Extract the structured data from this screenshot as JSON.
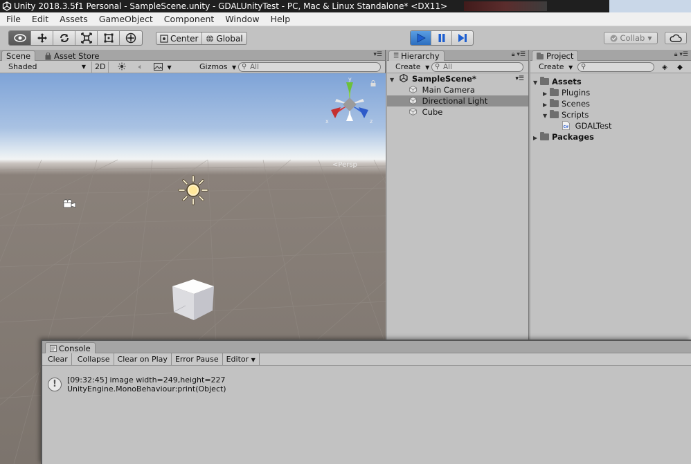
{
  "window": {
    "title": "Unity 2018.3.5f1 Personal - SampleScene.unity - GDALUnityTest - PC, Mac & Linux Standalone* <DX11>"
  },
  "menu": [
    "File",
    "Edit",
    "Assets",
    "GameObject",
    "Component",
    "Window",
    "Help"
  ],
  "toolbar": {
    "pivot_label": "Center",
    "space_label": "Global",
    "collab_label": "Collab"
  },
  "scene": {
    "tab_label": "Scene",
    "asset_store_tab_label": "Asset Store",
    "shading_mode": "Shaded",
    "mode_2d_label": "2D",
    "gizmos_label": "Gizmos",
    "search_placeholder": "All",
    "gizmo_axes": {
      "x": "x",
      "y": "y",
      "z": "z"
    },
    "projection_label": "Persp"
  },
  "hierarchy": {
    "tab_label": "Hierarchy",
    "create_label": "Create",
    "search_placeholder": "All",
    "scene_name": "SampleScene*",
    "items": [
      "Main Camera",
      "Directional Light",
      "Cube"
    ],
    "selected_item": "Directional Light"
  },
  "project": {
    "tab_label": "Project",
    "create_label": "Create",
    "tree": {
      "assets": "Assets",
      "plugins": "Plugins",
      "scenes": "Scenes",
      "scripts": "Scripts",
      "script_file": "GDALTest",
      "packages": "Packages"
    }
  },
  "console": {
    "tab_label": "Console",
    "buttons": [
      "Clear",
      "Collapse",
      "Clear on Play",
      "Error Pause",
      "Editor"
    ],
    "log": {
      "line1": "[09:32:45] image width=249,height=227",
      "line2": "UnityEngine.MonoBehaviour:print(Object)"
    }
  }
}
